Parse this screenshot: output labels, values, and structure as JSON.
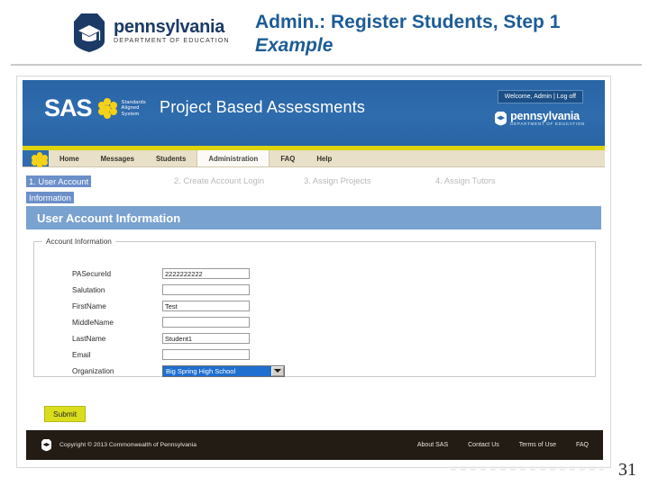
{
  "slide": {
    "title_line1": "Admin.:  Register Students, Step 1",
    "title_line2": "Example",
    "page_number": "31",
    "logo": {
      "name": "pennsylvania",
      "subtitle": "DEPARTMENT OF EDUCATION"
    }
  },
  "app": {
    "brand": {
      "acronym": "SAS",
      "tagline_line1": "Standards",
      "tagline_line2": "Aligned",
      "tagline_line3": "System"
    },
    "app_title": "Project Based Assessments",
    "welcome": "Welcome, Admin | Log off",
    "banner_logo": {
      "name": "pennsylvania",
      "subtitle": "DEPARTMENT OF EDUCATION"
    },
    "nav": [
      {
        "label": "Home",
        "active": false
      },
      {
        "label": "Messages",
        "active": false
      },
      {
        "label": "Students",
        "active": false
      },
      {
        "label": "Administration",
        "active": true
      },
      {
        "label": "FAQ",
        "active": false
      },
      {
        "label": "Help",
        "active": false
      }
    ],
    "wizard": {
      "step1": "1. User Account Information",
      "step2": "2. Create Account Login",
      "step3": "3. Assign Projects",
      "step4": "4. Assign Tutors"
    },
    "panel": {
      "heading": "User Account Information",
      "legend": "Account Information",
      "fields": [
        {
          "label": "PASecureId",
          "value": "2222222222",
          "type": "text"
        },
        {
          "label": "Salutation",
          "value": "",
          "type": "text"
        },
        {
          "label": "FirstName",
          "value": "Test",
          "type": "text"
        },
        {
          "label": "MiddleName",
          "value": "",
          "type": "text"
        },
        {
          "label": "LastName",
          "value": "Student1",
          "type": "text"
        },
        {
          "label": "Email",
          "value": "",
          "type": "text"
        },
        {
          "label": "Organization",
          "value": "Big Spring High School",
          "type": "select"
        }
      ],
      "submit_label": "Submit"
    },
    "footer": {
      "copyright": "Copyright © 2013 Commonwealth of Pennsylvania",
      "links": [
        "About SAS",
        "Contact Us",
        "Terms of Use",
        "FAQ"
      ]
    }
  },
  "colors": {
    "title_blue": "#1d5c96",
    "banner_blue": "#2e6cad",
    "panel_blue": "#7aa2d0",
    "accent_yellow": "#ddd40c",
    "submit_yellow": "#d9dd1c",
    "nav_tan": "#e8e0c8",
    "footer_dark": "#221c14",
    "highlight_blue": "#6b8fc9"
  }
}
